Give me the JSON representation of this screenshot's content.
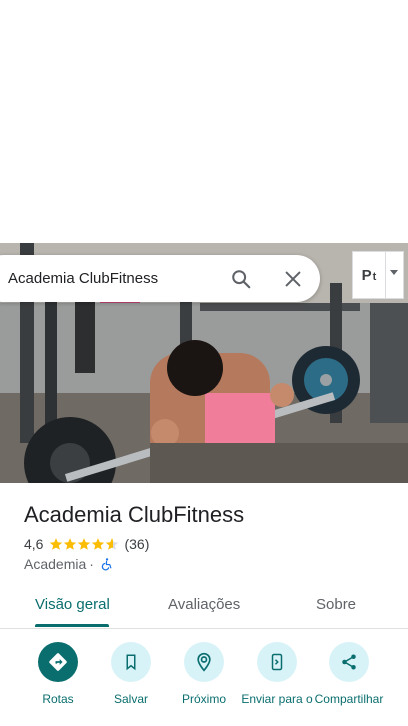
{
  "search": {
    "query": "Academia ClubFitness"
  },
  "language_button": {
    "label": "P",
    "sub": "t"
  },
  "place": {
    "name": "Academia ClubFitness",
    "rating": "4,6",
    "rating_value": 4.6,
    "review_count": "(36)",
    "category": "Academia",
    "separator": "·"
  },
  "tabs": [
    {
      "label": "Visão geral",
      "active": true
    },
    {
      "label": "Avaliações",
      "active": false
    },
    {
      "label": "Sobre",
      "active": false
    }
  ],
  "actions": [
    {
      "label": "Rotas",
      "icon": "directions-icon"
    },
    {
      "label": "Salvar",
      "icon": "bookmark-icon"
    },
    {
      "label": "Próximo",
      "icon": "nearby-icon"
    },
    {
      "label": "Enviar para o",
      "icon": "send-to-phone-icon"
    },
    {
      "label": "Compartilhar",
      "icon": "share-icon"
    }
  ],
  "colors": {
    "accent": "#0b6e6e",
    "action_bg": "#d7f3f8",
    "star": "#fbbc04"
  }
}
